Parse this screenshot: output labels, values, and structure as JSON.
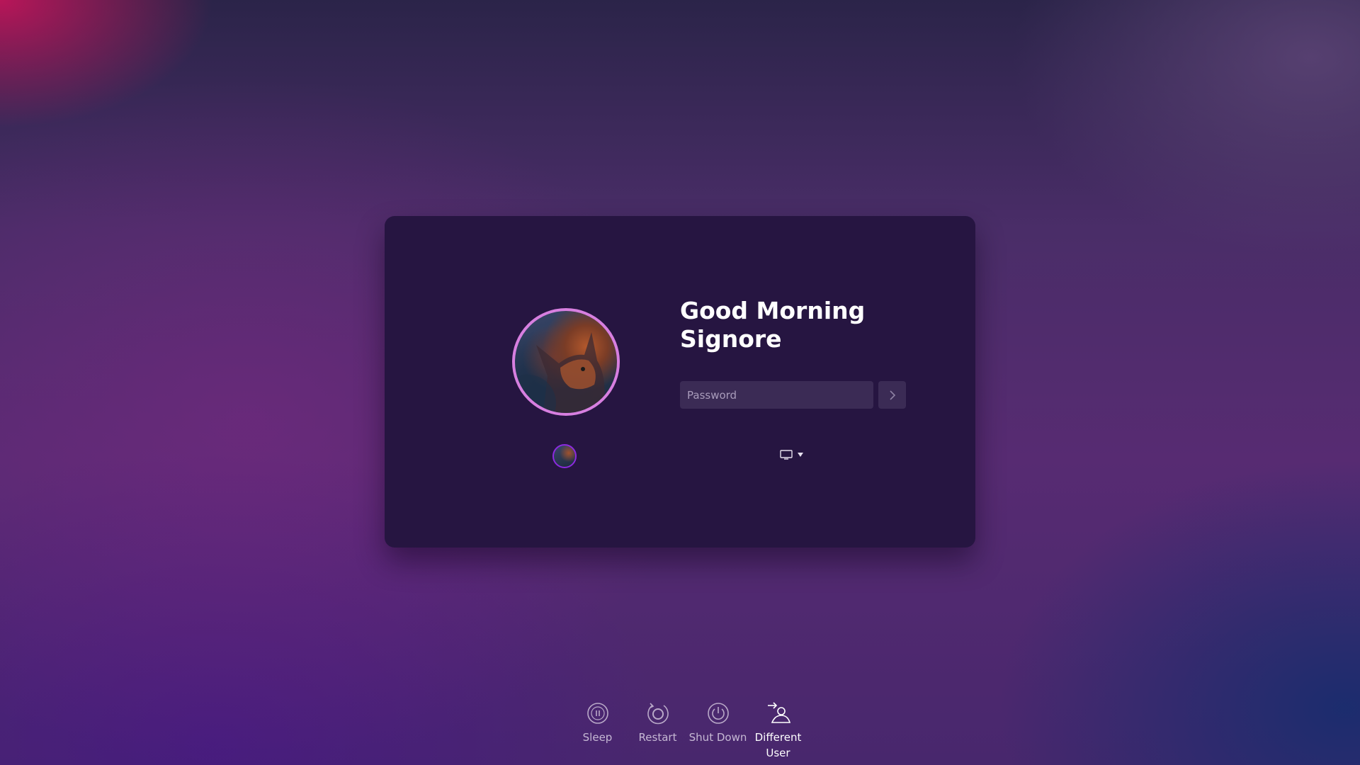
{
  "greeting": {
    "line1": "Good Morning",
    "line2": "Signore"
  },
  "login": {
    "password_placeholder": "Password",
    "submit_icon": "chevron-right-icon"
  },
  "user": {
    "avatar": "cat-avatar",
    "selected_user_avatar": "cat-avatar-small"
  },
  "session": {
    "icon": "monitor-icon",
    "dropdown_icon": "caret-down-icon"
  },
  "actions": [
    {
      "label": "Sleep",
      "icon": "sleep-icon"
    },
    {
      "label": "Restart",
      "icon": "restart-icon"
    },
    {
      "label": "Shut Down",
      "icon": "power-icon"
    },
    {
      "label": "Different User",
      "icon": "switch-user-icon"
    }
  ],
  "colors": {
    "card_background": "#261541",
    "avatar_ring": "#d77fe0",
    "selected_user_ring": "#8c2ae0",
    "input_background": "#3b2b55"
  }
}
